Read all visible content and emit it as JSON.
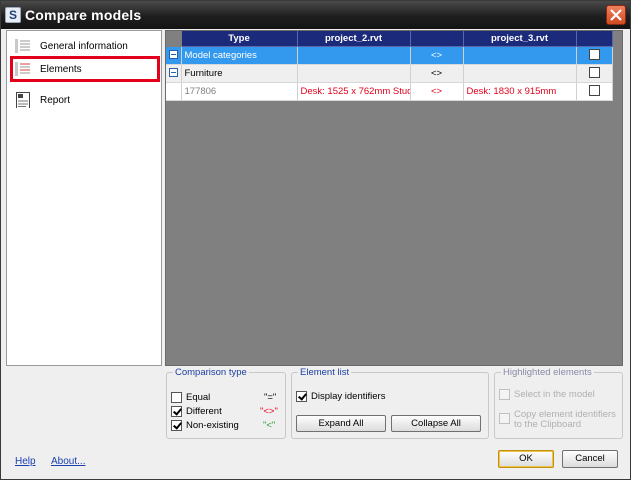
{
  "window": {
    "title": "Compare models",
    "logo_letter": "S"
  },
  "nav": {
    "items": [
      {
        "label": "General information",
        "icon": "list-icon"
      },
      {
        "label": "Elements",
        "icon": "elements-list-icon",
        "selected": true
      },
      {
        "label": "Report",
        "icon": "report-icon"
      }
    ]
  },
  "grid": {
    "headers": [
      "Type",
      "project_2.rvt",
      "",
      "project_3.rvt",
      ""
    ],
    "rows": [
      {
        "type": "Model categories",
        "left": "",
        "cmp": "<>",
        "right": ""
      },
      {
        "type": "Furniture",
        "left": "",
        "cmp": "<>",
        "right": ""
      },
      {
        "type": "177806",
        "left": "Desk: 1525 x 762mm Stud...",
        "cmp": "<>",
        "right": "Desk: 1830 x 915mm"
      }
    ]
  },
  "comparison_type": {
    "title": "Comparison type",
    "items": [
      {
        "label": "Equal",
        "symbol": "\"=\"",
        "checked": false,
        "symbol_color": "#000000"
      },
      {
        "label": "Different",
        "symbol": "\"<>\"",
        "checked": true,
        "symbol_color": "#e2001a"
      },
      {
        "label": "Non-existing",
        "symbol": "\"<\"",
        "checked": true,
        "symbol_color": "#1e9e2e"
      }
    ]
  },
  "element_list": {
    "title": "Element list",
    "display_identifiers": "Display identifiers",
    "expand_all": "Expand All",
    "collapse_all": "Collapse All"
  },
  "highlighted": {
    "title": "Highlighted elements",
    "select_in_model": "Select in the model",
    "copy_line1": "Copy element identifiers",
    "copy_line2": "to the Clipboard"
  },
  "footer": {
    "help": "Help",
    "about": "About...",
    "ok": "OK",
    "cancel": "Cancel"
  },
  "colors": {
    "title_bar": "#1e1e1e",
    "header": "#1b2a7a",
    "selection": "#3399ee",
    "highlight_border": "#e2001a"
  }
}
